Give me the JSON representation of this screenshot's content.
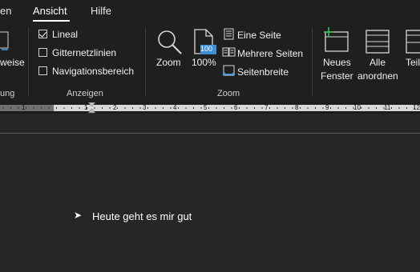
{
  "tabs": [
    {
      "label": "en"
    },
    {
      "label": "Ansicht"
    },
    {
      "label": "Hilfe"
    }
  ],
  "ribbon": {
    "left_partial": {
      "label": "weise",
      "group_label": "ung"
    },
    "anzeigen": {
      "group_label": "Anzeigen",
      "items": [
        {
          "label": "Lineal",
          "checked": true
        },
        {
          "label": "Gitternetzlinien",
          "checked": false
        },
        {
          "label": "Navigationsbereich",
          "checked": false
        }
      ]
    },
    "zoom": {
      "group_label": "Zoom",
      "zoom_label": "Zoom",
      "percent_label": "100%",
      "percent_badge": "100",
      "eine_seite": "Eine Seite",
      "mehrere_seiten": "Mehrere Seiten",
      "seitenbreite": "Seitenbreite"
    },
    "fenster": {
      "neues_fenster_line1": "Neues",
      "neues_fenster_line2": "Fenster",
      "alle_line1": "Alle",
      "alle_line2": "anordnen",
      "teilen_partial": "Teil"
    }
  },
  "ruler": {
    "ticks": [
      "1",
      "1",
      "2",
      "3",
      "4",
      "5",
      "6",
      "7",
      "8",
      "9",
      "10",
      "11",
      "12"
    ]
  },
  "document": {
    "bullet": "➤",
    "text": "Heute geht es mir gut"
  }
}
